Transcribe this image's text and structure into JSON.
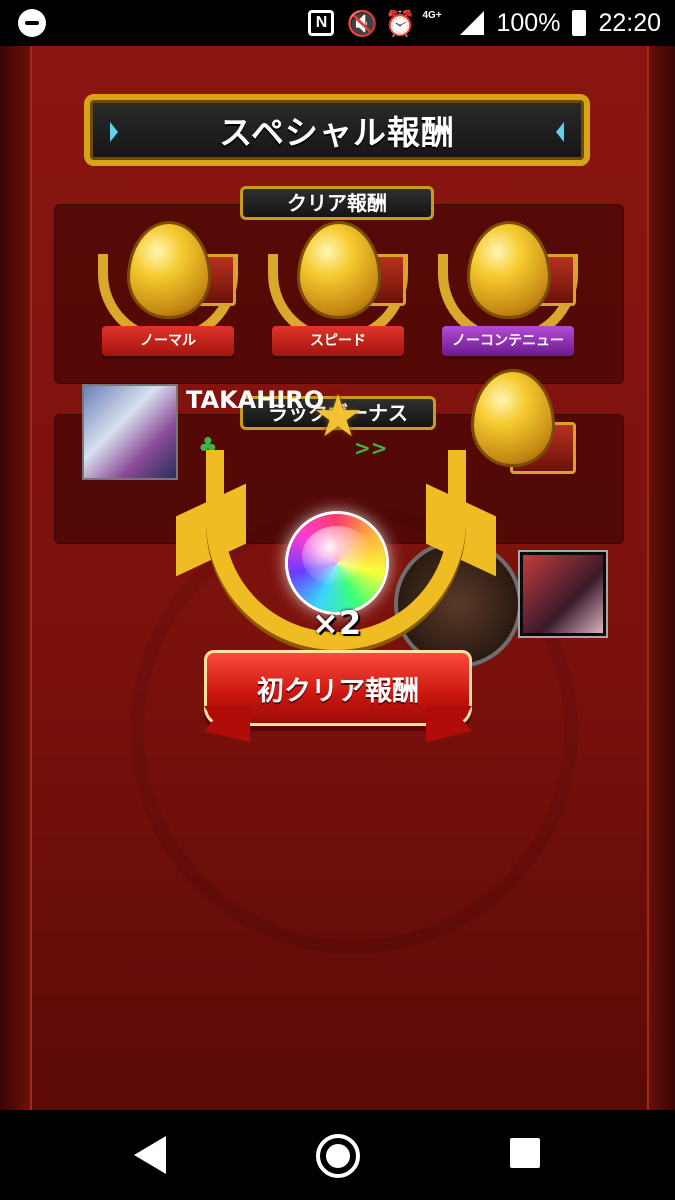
{
  "status_bar": {
    "nfc_label": "N",
    "battery_percent": "100%",
    "time": "22:20",
    "network": "4G+"
  },
  "title": "スペシャル報酬",
  "clear_reward": {
    "header": "クリア報酬",
    "items": [
      {
        "label": "ノーマル",
        "color": "red"
      },
      {
        "label": "スピード",
        "color": "red"
      },
      {
        "label": "ノーコンテニュー",
        "color": "purple"
      }
    ]
  },
  "luck_bonus": {
    "header": "ラックボーナス",
    "player_name": "TAKAHIRO"
  },
  "popup": {
    "multiplier": "×2",
    "banner": "初クリア報酬"
  },
  "colors": {
    "gold": "#f0bc24",
    "background_red": "#7a0f0a",
    "ribbon_red": "#c8150f",
    "ribbon_purple": "#6b1a8f"
  }
}
